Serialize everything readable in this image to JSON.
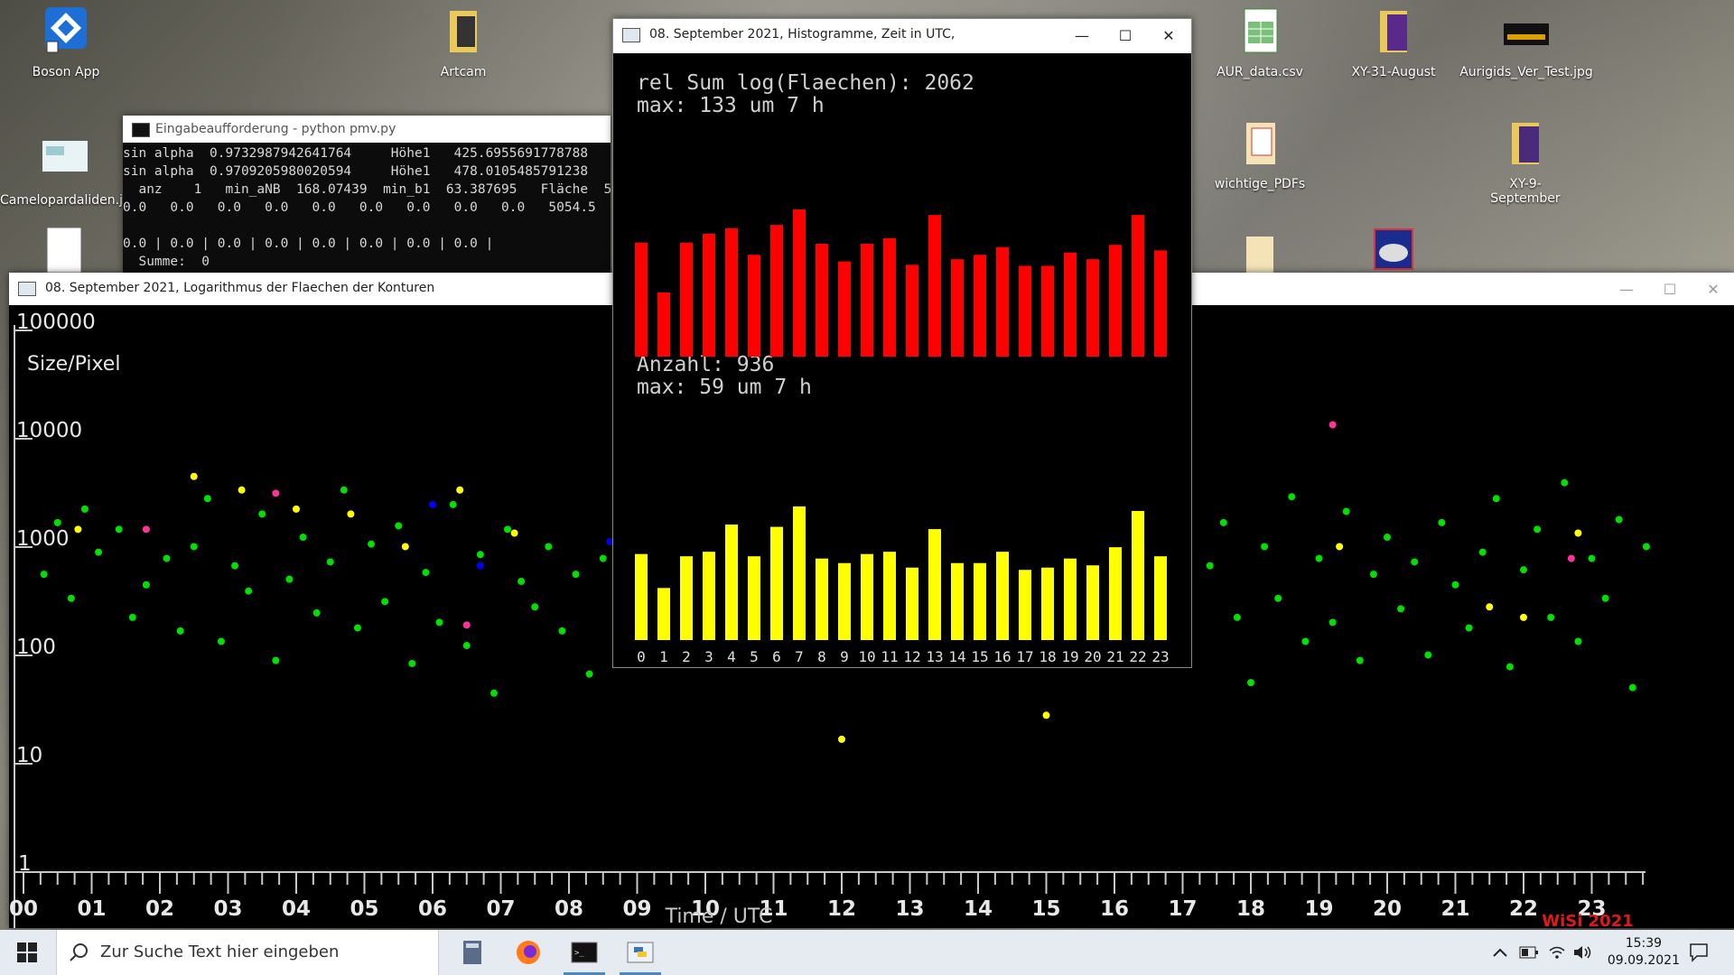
{
  "desktop": {
    "icons": [
      {
        "label": "Boson App"
      },
      {
        "label": "Artcam"
      },
      {
        "label": "AUR_data.csv"
      },
      {
        "label": "XY-31-August"
      },
      {
        "label": "Aurigids_Ver_Test.jpg"
      },
      {
        "label": "Camelopardaliden.j..."
      },
      {
        "label": "wichtige_PDFs"
      },
      {
        "label": "XY-9-September"
      }
    ]
  },
  "console": {
    "title": "Eingabeaufforderung - python  pmv.py",
    "lines": [
      "sin alpha  0.9732987942641764     Höhe1   425.6955691778788",
      "sin alpha  0.9709205980020594     Höhe1   478.0105485791238",
      "  anz    1   min_aNB  168.07439  min_b1  63.387695   Fläche  5",
      "0.0   0.0   0.0   0.0   0.0   0.0   0.0   0.0   0.0   5054.5",
      "",
      "0.0 | 0.0 | 0.0 | 0.0 | 0.0 | 0.0 | 0.0 | 0.0 |",
      "  Summe:  0"
    ]
  },
  "scatter_window": {
    "title": "08. September 2021, Logarithmus der Flaechen der Konturen",
    "ylabel": "Size/Pixel",
    "xlabel": "Time  /  UTC",
    "watermark": "WiSi 2021",
    "y_ticks": [
      "100000",
      "10000",
      "1000",
      "100",
      "10",
      "1"
    ],
    "x_ticks": [
      "00",
      "01",
      "02",
      "03",
      "04",
      "05",
      "06",
      "07",
      "08",
      "09",
      "10",
      "11",
      "12",
      "13",
      "14",
      "15",
      "16",
      "17",
      "18",
      "19",
      "20",
      "21",
      "22",
      "23"
    ]
  },
  "hist_window": {
    "title": "08. September 2021, Histogramme, Zeit in UTC,",
    "top_line1": "rel Sum log(Flaechen): 2062",
    "top_line2": "max: 133 um 7 h",
    "bottom_line1": "Anzahl: 936",
    "bottom_line2": "max: 59 um 7 h",
    "hour_labels": [
      "0",
      "1",
      "2",
      "3",
      "4",
      "5",
      "6",
      "7",
      "8",
      "9",
      "10",
      "11",
      "12",
      "13",
      "14",
      "15",
      "16",
      "17",
      "18",
      "19",
      "20",
      "21",
      "22",
      "23"
    ]
  },
  "chart_data": [
    {
      "type": "bar",
      "categories": [
        "0",
        "1",
        "2",
        "3",
        "4",
        "5",
        "6",
        "7",
        "8",
        "9",
        "10",
        "11",
        "12",
        "13",
        "14",
        "15",
        "16",
        "17",
        "18",
        "19",
        "20",
        "21",
        "22",
        "23"
      ],
      "values": [
        103,
        58,
        103,
        111,
        116,
        92,
        119,
        133,
        102,
        86,
        102,
        107,
        83,
        128,
        88,
        92,
        99,
        82,
        82,
        94,
        88,
        101,
        128,
        96
      ],
      "color": "#ff0000"
    },
    {
      "type": "bar",
      "categories": [
        "0",
        "1",
        "2",
        "3",
        "4",
        "5",
        "6",
        "7",
        "8",
        "9",
        "10",
        "11",
        "12",
        "13",
        "14",
        "15",
        "16",
        "17",
        "18",
        "19",
        "20",
        "21",
        "22",
        "23"
      ],
      "values": [
        38,
        23,
        37,
        39,
        51,
        37,
        50,
        59,
        36,
        34,
        38,
        39,
        32,
        49,
        34,
        34,
        39,
        31,
        32,
        36,
        33,
        41,
        57,
        37
      ],
      "color": "#ffff00"
    },
    {
      "type": "scatter",
      "xlabel": "Time  /  UTC",
      "ylabel": "Size/Pixel",
      "xlim": [
        0,
        24
      ],
      "ylim": [
        1,
        100000
      ],
      "yscale": "log",
      "series": [
        {
          "color": "#00e000",
          "points": [
            [
              0.3,
              500
            ],
            [
              0.5,
              1500
            ],
            [
              0.7,
              300
            ],
            [
              0.9,
              2000
            ],
            [
              1.1,
              800
            ],
            [
              1.4,
              1300
            ],
            [
              1.6,
              200
            ],
            [
              1.8,
              400
            ],
            [
              2.1,
              700
            ],
            [
              2.3,
              150
            ],
            [
              2.5,
              900
            ],
            [
              2.7,
              2500
            ],
            [
              2.9,
              120
            ],
            [
              3.1,
              600
            ],
            [
              3.3,
              350
            ],
            [
              3.5,
              1800
            ],
            [
              3.7,
              80
            ],
            [
              3.9,
              450
            ],
            [
              4.1,
              1100
            ],
            [
              4.3,
              220
            ],
            [
              4.5,
              650
            ],
            [
              4.7,
              3000
            ],
            [
              4.9,
              160
            ],
            [
              5.1,
              950
            ],
            [
              5.3,
              280
            ],
            [
              5.5,
              1400
            ],
            [
              5.7,
              75
            ],
            [
              5.9,
              520
            ],
            [
              6.1,
              180
            ],
            [
              6.3,
              2200
            ],
            [
              6.5,
              110
            ],
            [
              6.7,
              760
            ],
            [
              6.9,
              40
            ],
            [
              7.1,
              1300
            ],
            [
              7.3,
              430
            ],
            [
              7.5,
              250
            ],
            [
              7.7,
              900
            ],
            [
              7.9,
              150
            ],
            [
              8.1,
              500
            ],
            [
              8.3,
              60
            ],
            [
              8.5,
              700
            ],
            [
              17.4,
              600
            ],
            [
              17.6,
              1500
            ],
            [
              17.8,
              200
            ],
            [
              18.0,
              50
            ],
            [
              18.2,
              900
            ],
            [
              18.4,
              300
            ],
            [
              18.6,
              2600
            ],
            [
              18.8,
              120
            ],
            [
              19.0,
              700
            ],
            [
              19.2,
              180
            ],
            [
              19.4,
              1900
            ],
            [
              19.6,
              80
            ],
            [
              19.8,
              500
            ],
            [
              20.0,
              1100
            ],
            [
              20.2,
              240
            ],
            [
              20.4,
              650
            ],
            [
              20.6,
              90
            ],
            [
              20.8,
              1500
            ],
            [
              21.0,
              400
            ],
            [
              21.2,
              160
            ],
            [
              21.4,
              800
            ],
            [
              21.6,
              2500
            ],
            [
              21.8,
              70
            ],
            [
              22.0,
              550
            ],
            [
              22.2,
              1300
            ],
            [
              22.4,
              200
            ],
            [
              22.6,
              3500
            ],
            [
              22.8,
              120
            ],
            [
              23.0,
              700
            ],
            [
              23.2,
              300
            ],
            [
              23.4,
              1600
            ],
            [
              23.6,
              45
            ],
            [
              23.8,
              900
            ]
          ]
        },
        {
          "color": "#ffff00",
          "points": [
            [
              0.8,
              1300
            ],
            [
              2.5,
              4000
            ],
            [
              3.2,
              3000
            ],
            [
              4.0,
              2000
            ],
            [
              4.8,
              1800
            ],
            [
              5.6,
              900
            ],
            [
              6.4,
              3000
            ],
            [
              7.2,
              1200
            ],
            [
              12.0,
              15
            ],
            [
              15.0,
              25
            ],
            [
              19.3,
              900
            ],
            [
              21.5,
              250
            ],
            [
              22.0,
              200
            ],
            [
              22.8,
              1200
            ]
          ]
        },
        {
          "color": "#ff3399",
          "points": [
            [
              1.8,
              1300
            ],
            [
              3.7,
              2800
            ],
            [
              6.5,
              170
            ],
            [
              19.2,
              12000
            ],
            [
              22.7,
              700
            ]
          ]
        },
        {
          "color": "#0000ff",
          "points": [
            [
              6.0,
              2200
            ],
            [
              6.7,
              600
            ],
            [
              8.6,
              1000
            ]
          ]
        }
      ]
    }
  ],
  "taskbar": {
    "search_placeholder": "Zur Suche Text hier eingeben",
    "time": "15:39",
    "date": "09.09.2021"
  }
}
